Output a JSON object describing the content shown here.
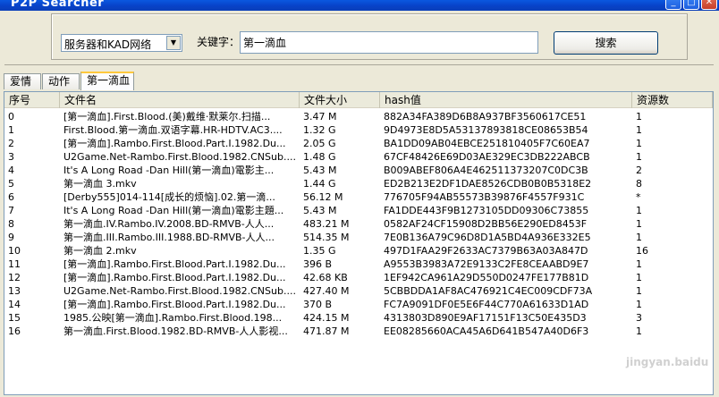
{
  "window": {
    "title": "P2P Searcher",
    "min_glyph": "_",
    "max_glyph": "□",
    "close_glyph": "✕"
  },
  "search": {
    "source_select_value": "服务器和KAD网络",
    "keyword_label": "关键字：",
    "keyword_value": "第一滴血",
    "button_label": "搜索"
  },
  "tabs": [
    {
      "label": "爱情"
    },
    {
      "label": "动作"
    },
    {
      "label": "第一滴血"
    }
  ],
  "table": {
    "columns": [
      "序号",
      "文件名",
      "文件大小",
      "hash值",
      "资源数"
    ],
    "rows": [
      [
        "0",
        "[第一滴血].First.Blood.(美)戴维·默莱尔.扫描...",
        "3.47 M",
        "882A34FA389D6B8A937BF3560617CE51",
        "1"
      ],
      [
        "1",
        "First.Blood.第一滴血.双语字幕.HR-HDTV.AC3....",
        "1.32 G",
        "9D4973E8D5A53137893818CE08653B54",
        "1"
      ],
      [
        "2",
        "[第一滴血].Rambo.First.Blood.Part.I.1982.Du...",
        "2.05 G",
        "BA1DD09AB04EBCE251810405F7C60EA7",
        "1"
      ],
      [
        "3",
        "U2Game.Net-Rambo.First.Blood.1982.CNSub....",
        "1.48 G",
        "67CF48426E69D03AE329EC3DB222ABCB",
        "1"
      ],
      [
        "4",
        " It's A Long Road -Dan Hill(第一滴血)電影主...",
        "5.43 M",
        "B009ABEF806A4E462511373207C0DC3B",
        "2"
      ],
      [
        "5",
        "第一滴血  3.mkv",
        "1.44 G",
        "ED2B213E2DF1DAE8526CDB0B0B5318E2",
        "8"
      ],
      [
        "6",
        "[Derby555]014-114[成长的烦恼].02.第一滴...",
        "56.12 M",
        "776705F94AB55573B39876F4557F931C",
        "*"
      ],
      [
        "7",
        "It's A Long Road -Dan Hill(第一滴血)電影主題...",
        "5.43 M",
        "FA1DDE443F9B1273105DD09306C73855",
        "1"
      ],
      [
        "8",
        "第一滴血.IV.Rambo.IV.2008.BD-RMVB-人人...",
        "483.21 M",
        "0582AF24CF15908D2BB56E290ED8453F",
        "1"
      ],
      [
        "9",
        "第一滴血.III.Rambo.III.1988.BD-RMVB-人人...",
        "514.35 M",
        "7E0B136A79C96D8D1A5BD4A936E332E5",
        "1"
      ],
      [
        "10",
        "第一滴血  2.mkv",
        "1.35 G",
        "497D1FAA29F2633AC7379B63A03A847D",
        "16"
      ],
      [
        "11",
        "[第一滴血].Rambo.First.Blood.Part.I.1982.Du...",
        "396 B",
        "A9553B3983A72E9133C2FE8CEAABD9E7",
        "1"
      ],
      [
        "12",
        "[第一滴血].Rambo.First.Blood.Part.I.1982.Du...",
        "42.68 KB",
        "1EF942CA961A29D550D0247FE177B81D",
        "1"
      ],
      [
        "13",
        "U2Game.Net-Rambo.First.Blood.1982.CNSub....",
        "427.40 M",
        "5CBBDDA1AF8AC476921C4EC009CDF73A",
        "1"
      ],
      [
        "14",
        "[第一滴血].Rambo.First.Blood.Part.I.1982.Du...",
        "370 B",
        "FC7A9091DF0E5E6F44C770A61633D1AD",
        "1"
      ],
      [
        "15",
        "1985.公映[第一滴血].Rambo.First.Blood.198...",
        "424.15 M",
        "4313803D890E9AF17151F13C50E435D3",
        "3"
      ],
      [
        "16",
        "第一滴血.First.Blood.1982.BD-RMVB-人人影视...",
        "471.87 M",
        "EE08285660ACA45A6D641B547A40D6F3",
        "1"
      ]
    ]
  },
  "watermark": "jingyan.baidu"
}
